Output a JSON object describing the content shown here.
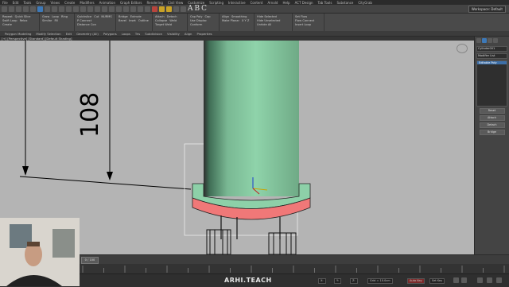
{
  "menubar": {
    "items": [
      "File",
      "Edit",
      "Tools",
      "Group",
      "Views",
      "Create",
      "Modifiers",
      "Animation",
      "Graph Editors",
      "Rendering",
      "Civil View",
      "Customize",
      "Scripting",
      "Interactive",
      "Content",
      "Arnold",
      "Help",
      "ACT Design",
      "Tab Tools",
      "Substance",
      "CityGrab"
    ]
  },
  "toolbar": {
    "text_glyphs": [
      "A",
      "B",
      "C"
    ],
    "workspace": "Workspace: Default"
  },
  "ribbon": {
    "groups": [
      {
        "items": [
          "Repeat",
          "Quick Slice",
          "Swift Loop",
          "Relax",
          "Create"
        ]
      },
      {
        "items": [
          "Grow",
          "Loop",
          "Ring",
          "Similar",
          "Fill"
        ]
      },
      {
        "items": [
          "Quickslice",
          "Cut",
          "NURMS",
          "P Connect",
          "Distance Con"
        ]
      },
      {
        "items": [
          "Bridge",
          "Extrude",
          "Bevel",
          "Inset",
          "Outline"
        ]
      },
      {
        "items": [
          "Attach",
          "Detach",
          "Collapse",
          "Weld",
          "Target Weld"
        ]
      },
      {
        "items": [
          "Cap Poly",
          "Cap",
          "Use Displac",
          "Conform"
        ]
      },
      {
        "items": [
          "Align",
          "Smoothing",
          "Make Planar",
          "X Y Z"
        ]
      },
      {
        "items": [
          "Hide Selected",
          "Hide Unselected",
          "Unhide All"
        ]
      },
      {
        "items": [
          "Set Flow",
          "Flow Connect",
          "Insert Loop"
        ]
      }
    ],
    "labels": [
      "Polygon Modeling",
      "Modify Selection",
      "Edit",
      "Geometry (All)",
      "Polygons",
      "Loops",
      "Tris",
      "Subdivision",
      "Visibility",
      "Align",
      "Properties"
    ]
  },
  "viewport": {
    "label": "[+] [Perspective] [Standard] [Default Shading]",
    "dimension_text": "108"
  },
  "right_panel": {
    "object_name": "Cylinder001",
    "modifier_list_label": "Modifier List",
    "selected_item": "Editable Poly",
    "buttons": [
      "Reset",
      "Attach",
      "Detach",
      "Bridge"
    ]
  },
  "timeline": {
    "frame_readout": "0 / 100"
  },
  "statusbar": {
    "logo": "ARHI.TEACH",
    "fields": [
      "X:",
      "Y:",
      "Z:",
      "Grid = 10.0cm"
    ],
    "auto_key": "Auto Key",
    "set_key": "Set Key"
  },
  "colors": {
    "viewport_bg": "#b4b4b4",
    "cylinder": "#8dd0a8",
    "base_ring_top": "#8dd0a8",
    "base_ring_side": "#f07878",
    "ui_dark": "#3a3a3a",
    "accent": "#3d79b8"
  }
}
